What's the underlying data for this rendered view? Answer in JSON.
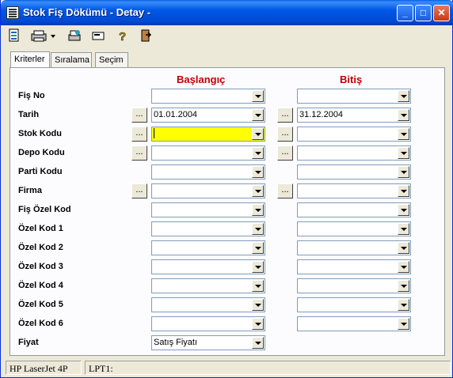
{
  "window": {
    "title": "Stok Fiş Dökümü - Detay -",
    "buttons": {
      "minimize": "_",
      "maximize": "□",
      "close": "✕"
    }
  },
  "toolbar": {
    "icons": [
      "preview-icon",
      "printer-icon",
      "printer-setup-icon",
      "card-icon",
      "help-icon",
      "exit-icon"
    ]
  },
  "tabs": [
    "Kriterler",
    "Sıralama",
    "Seçim"
  ],
  "headers": {
    "start": "Başlangıç",
    "end": "Bitiş"
  },
  "ellipsis": "...",
  "rows": [
    {
      "label": "Fiş No",
      "start": "",
      "end": ""
    },
    {
      "label": "Tarih",
      "start": "01.01.2004",
      "end": "31.12.2004"
    },
    {
      "label": "Stok Kodu",
      "start": "",
      "end": ""
    },
    {
      "label": "Depo Kodu",
      "start": "",
      "end": ""
    },
    {
      "label": "Parti Kodu",
      "start": "",
      "end": ""
    },
    {
      "label": "Firma",
      "start": "",
      "end": ""
    },
    {
      "label": "Fiş Özel Kod",
      "start": "",
      "end": ""
    },
    {
      "label": "Özel Kod 1",
      "start": "",
      "end": ""
    },
    {
      "label": "Özel Kod 2",
      "start": "",
      "end": ""
    },
    {
      "label": "Özel Kod 3",
      "start": "",
      "end": ""
    },
    {
      "label": "Özel Kod 4",
      "start": "",
      "end": ""
    },
    {
      "label": "Özel Kod 5",
      "start": "",
      "end": ""
    },
    {
      "label": "Özel Kod 6",
      "start": "",
      "end": ""
    },
    {
      "label": "Fiyat",
      "start": "Satış Fiyatı"
    }
  ],
  "status": {
    "printer": "HP LaserJet 4P",
    "port": "LPT1:"
  },
  "colors": {
    "header": "#C00000",
    "active_field": "#FFFF00",
    "titlebar": "#0058E6"
  }
}
